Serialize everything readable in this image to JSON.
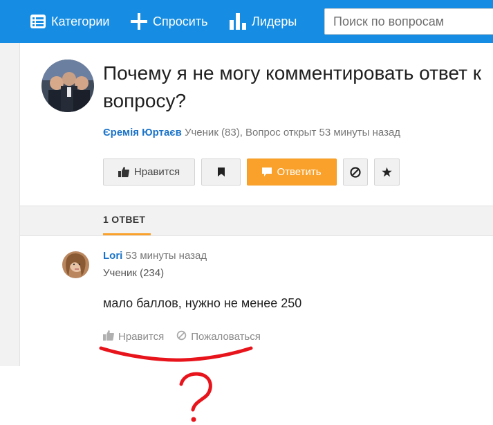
{
  "header": {
    "nav": [
      {
        "label": "Категории",
        "icon": "list-icon"
      },
      {
        "label": "Спросить",
        "icon": "plus-icon"
      },
      {
        "label": "Лидеры",
        "icon": "bar-chart-icon"
      }
    ],
    "search": {
      "placeholder": "Поиск по вопросам",
      "value": ""
    }
  },
  "question": {
    "title": "Почему я не могу комментировать ответ к вопросу?",
    "author": "Єремія Юртаєв",
    "meta": " Ученик (83), Вопрос открыт 53 минуты назад",
    "actions": {
      "like_label": "Нравится",
      "answer_label": "Ответить"
    }
  },
  "answers": {
    "tab_label": "1 ОТВЕТ",
    "items": [
      {
        "author": "Lori",
        "time": " 53 минуты назад",
        "rank": "Ученик (234)",
        "text": "мало баллов, нужно не менее 250",
        "like_label": "Нравится",
        "report_label": "Пожаловаться"
      }
    ]
  },
  "colors": {
    "topbar": "#168de2",
    "accent": "#f9a12a",
    "link": "#1a73c9",
    "annotation": "#e8141c"
  }
}
